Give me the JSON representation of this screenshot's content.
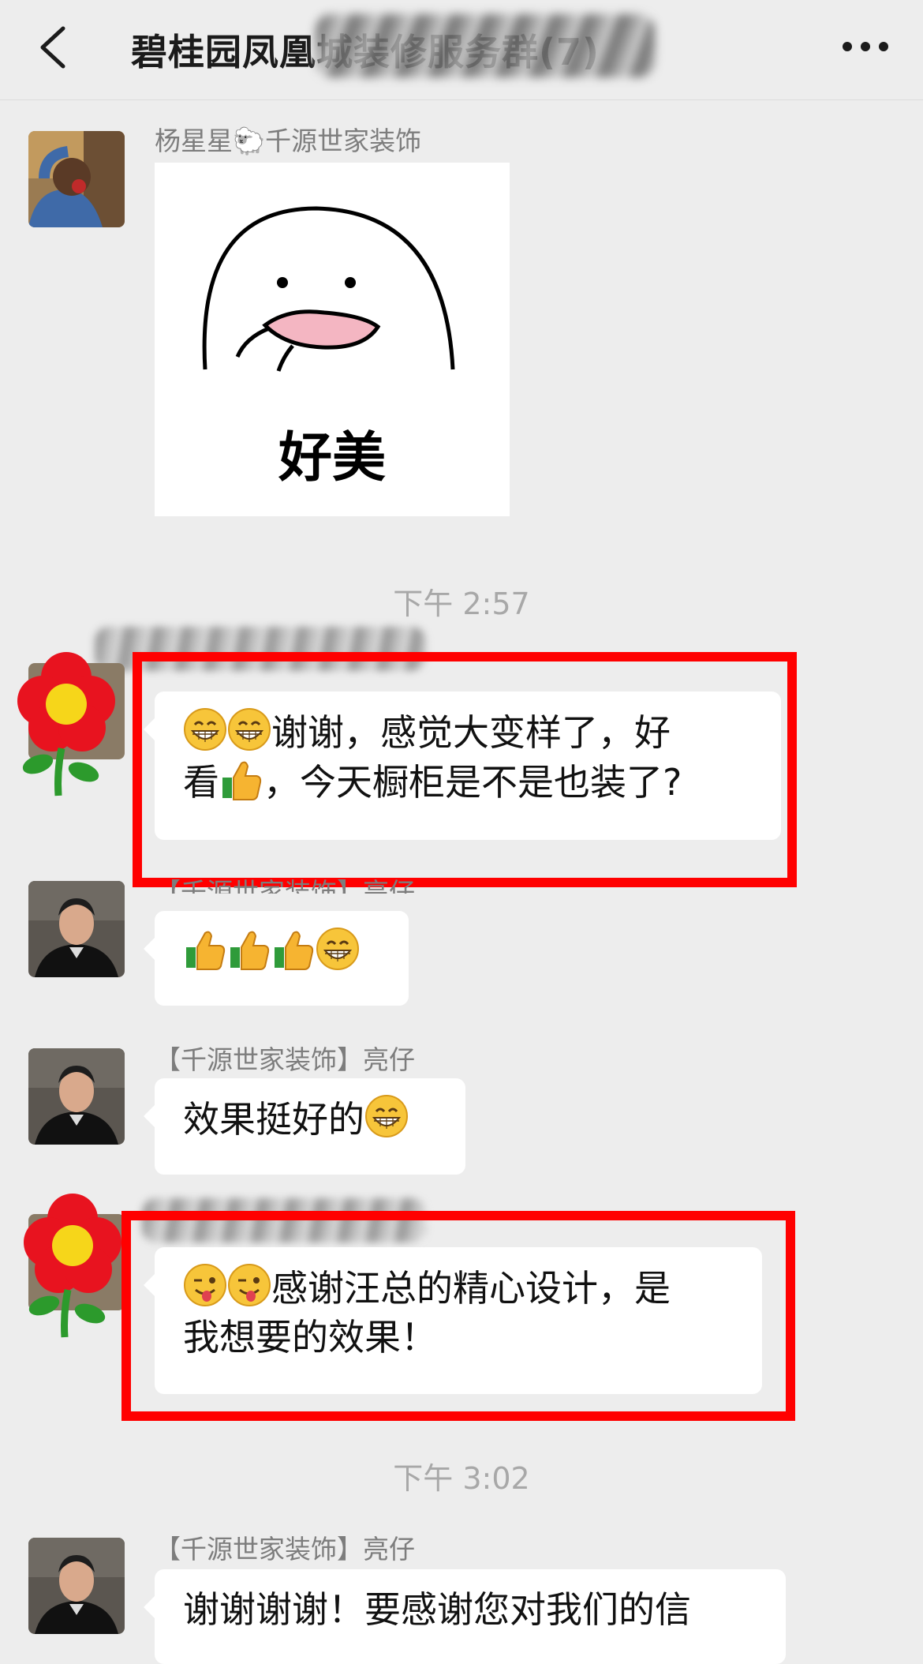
{
  "header": {
    "title": "碧桂园凤凰城装修服务群(7)"
  },
  "messages": [
    {
      "sender": "杨星星🐑千源世家装饰",
      "sticker_text": "好美"
    },
    {
      "timestamp": "下午 2:57"
    },
    {
      "text_line1": "谢谢，感觉大变样了，好",
      "text_line2_a": "看",
      "text_line2_b": "，今天橱柜是不是也装了?"
    },
    {
      "sender": "【千源世家装饰】亮仔"
    },
    {
      "sender": "【千源世家装饰】亮仔",
      "text": "效果挺好的"
    },
    {
      "text_line1": "感谢汪总的精心设计，是",
      "text_line2": "我想要的效果！"
    },
    {
      "timestamp": "下午 3:02"
    },
    {
      "sender": "【千源世家装饰】亮仔",
      "text": "谢谢谢谢！要感谢您对我们的信"
    }
  ],
  "icons": {
    "back": "chevron-left-icon",
    "more": "more-dots-icon",
    "grin": "grinning-emoji",
    "thumbs": "thumbs-up-emoji",
    "wink": "wink-tongue-emoji"
  },
  "colors": {
    "background": "#ededed",
    "bubble": "#ffffff",
    "highlight": "#ff0000"
  }
}
